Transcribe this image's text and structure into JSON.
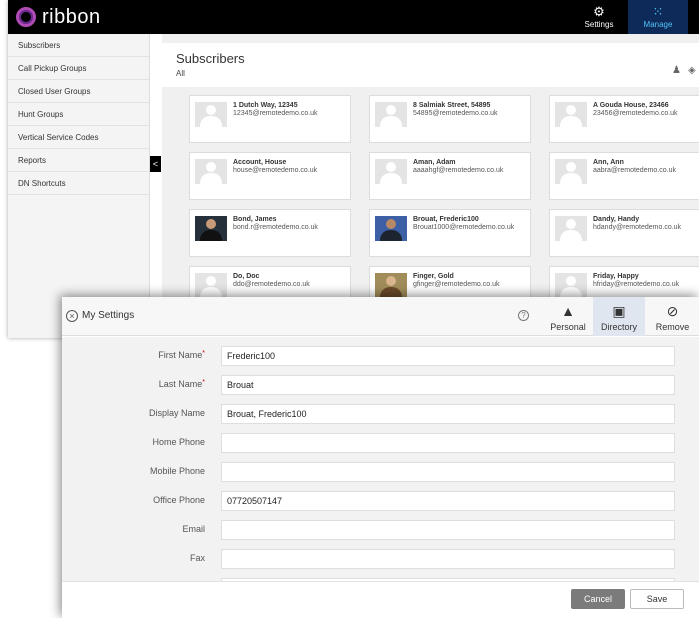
{
  "app": {
    "logo_text": "ribbon",
    "settings_label": "Settings",
    "manage_label": "Manage",
    "settings_icon": "gear-icon",
    "manage_icon": "network-icon",
    "accent_color": "#b14bb5",
    "manage_color": "#4fc3f7"
  },
  "sidebar": {
    "items": [
      {
        "label": "Subscribers"
      },
      {
        "label": "Call Pickup Groups"
      },
      {
        "label": "Closed User Groups"
      },
      {
        "label": "Hunt Groups"
      },
      {
        "label": "Vertical Service Codes"
      },
      {
        "label": "Reports"
      },
      {
        "label": "DN Shortcuts"
      }
    ],
    "collapse_glyph": "<"
  },
  "main": {
    "title": "Subscribers",
    "filter": "All",
    "cards": [
      {
        "name": "1 Dutch Way, 12345",
        "email": "12345@remotedemo.co.uk"
      },
      {
        "name": "8 Salmiak Street, 54895",
        "email": "54895@remotedemo.co.uk"
      },
      {
        "name": "A Gouda House, 23466",
        "email": "23456@remotedemo.co.uk"
      },
      {
        "name": "Account, House",
        "email": "house@remotedemo.co.uk"
      },
      {
        "name": "Aman, Adam",
        "email": "aaaahgf@remotedemo.co.uk"
      },
      {
        "name": "Ann, Ann",
        "email": "aabra@remotedemo.co.uk"
      },
      {
        "name": "Bond, James",
        "email": "bond.r@remotedemo.co.uk"
      },
      {
        "name": "Brouat, Frederic100",
        "email": "Brouat1000@remotedemo.co.uk"
      },
      {
        "name": "Dandy, Handy",
        "email": "hdandy@remotedemo.co.uk"
      },
      {
        "name": "Do, Doc",
        "email": "ddo@remotedemo.co.uk"
      },
      {
        "name": "Finger, Gold",
        "email": "gfinger@remotedemo.co.uk"
      },
      {
        "name": "Friday, Happy",
        "email": "hfriday@remotedemo.co.uk"
      }
    ]
  },
  "dialog": {
    "title": "My Settings",
    "tabs": [
      {
        "label": "Personal",
        "icon": "person-icon"
      },
      {
        "label": "Directory",
        "icon": "contact-card-icon"
      },
      {
        "label": "Remove",
        "icon": "prohibited-icon"
      }
    ],
    "fields": [
      {
        "label": "First Name",
        "required": "*",
        "value": "Frederic100"
      },
      {
        "label": "Last Name",
        "required": "*",
        "value": "Brouat"
      },
      {
        "label": "Display Name",
        "required": "",
        "value": "Brouat, Frederic100"
      },
      {
        "label": "Home Phone",
        "required": "",
        "value": ""
      },
      {
        "label": "Mobile Phone",
        "required": "",
        "value": ""
      },
      {
        "label": "Office Phone",
        "required": "",
        "value": "07720507147"
      },
      {
        "label": "Email",
        "required": "",
        "value": ""
      },
      {
        "label": "Fax",
        "required": "",
        "value": ""
      }
    ],
    "cancel_label": "Cancel",
    "save_label": "Save"
  }
}
